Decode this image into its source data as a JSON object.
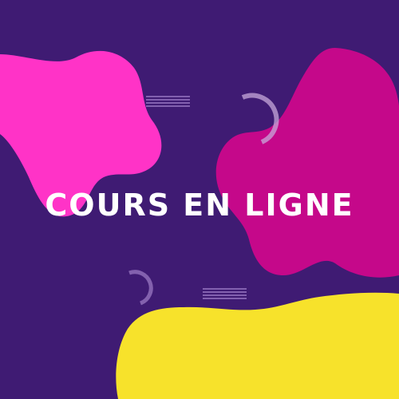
{
  "banner": {
    "title": "Cours en ligne",
    "colors": {
      "background": "#3f1b73",
      "pink_blob": "#ff33c7",
      "magenta_blob": "#c5088a",
      "yellow_blob": "#f7e22b",
      "text": "#ffffff"
    }
  }
}
